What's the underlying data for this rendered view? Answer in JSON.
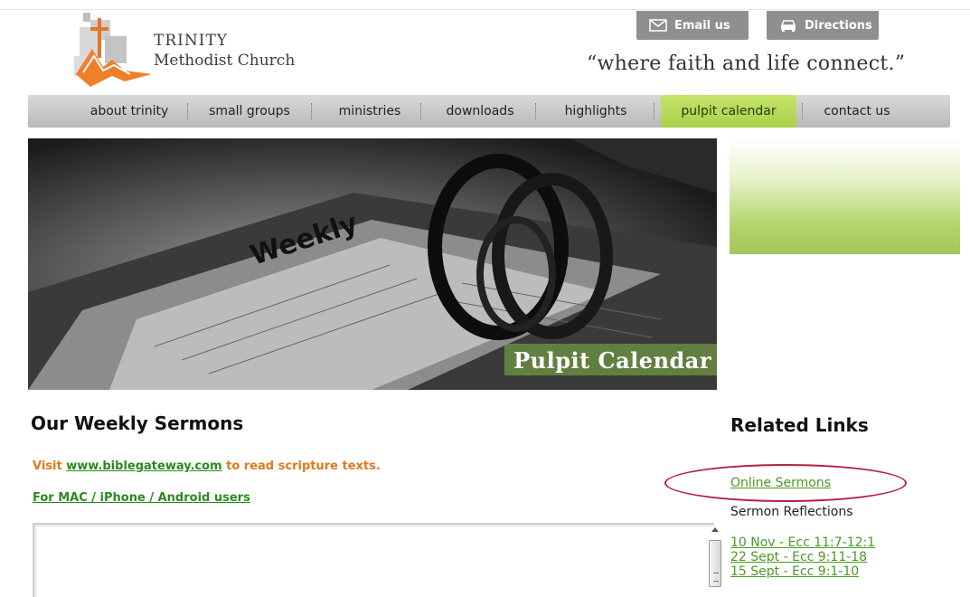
{
  "header": {
    "logo_line1": "TRINITY",
    "logo_line2": "Methodist Church",
    "email_label": "Email us",
    "directions_label": "Directions",
    "tagline": "“where faith and life connect.”"
  },
  "nav": {
    "items": [
      {
        "label": "about trinity"
      },
      {
        "label": "small groups"
      },
      {
        "label": "ministries"
      },
      {
        "label": "downloads"
      },
      {
        "label": "highlights"
      },
      {
        "label": "pulpit calendar",
        "active": true
      },
      {
        "label": "contact us"
      }
    ]
  },
  "hero": {
    "caption": "Pulpit Calendar"
  },
  "main": {
    "title": "Our Weekly Sermons",
    "visit_prefix": "Visit ",
    "visit_link": "www.biblegateway.com",
    "visit_suffix": " to read scripture texts.",
    "mac_link": "For MAC / iPhone / Android users"
  },
  "sidebar": {
    "title": "Related Links",
    "online_sermons": "Online Sermons",
    "reflections_label": "Sermon Reflections",
    "reflections": [
      "10 Nov - Ecc 11:7-12:1",
      "22 Sept - Ecc 9:11-18",
      "15 Sept - Ecc 9:1-10"
    ]
  },
  "colors": {
    "accent_green": "#a9d24a",
    "link_green": "#4a9a22",
    "orange_text": "#e1781c",
    "highlight_oval": "#b3214a"
  }
}
